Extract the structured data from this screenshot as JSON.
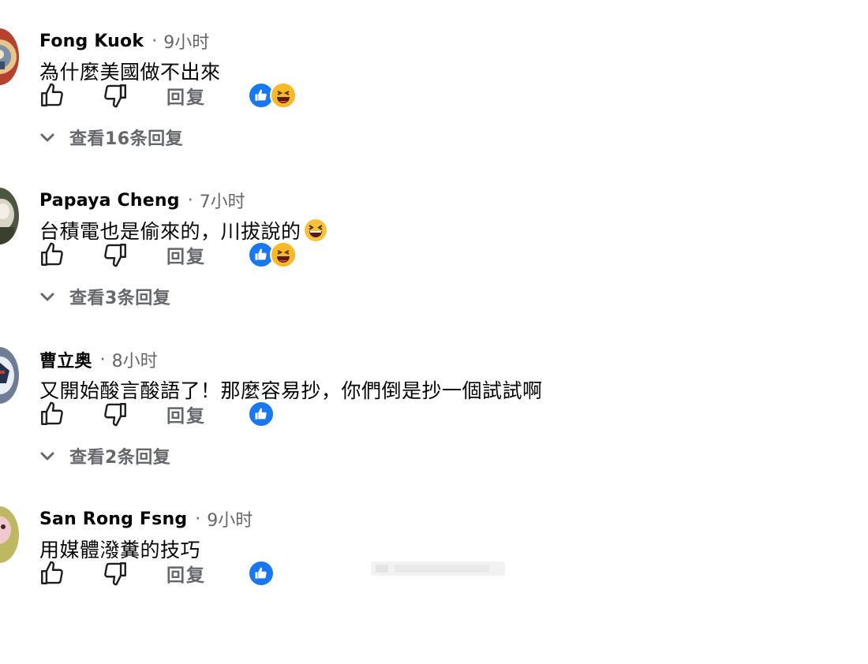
{
  "comments": [
    {
      "author": "Fong Kuok",
      "separator": "·",
      "time": "9小时",
      "text": "為什麼美國做不出來",
      "reply_label": "回复",
      "view_replies": "查看16条回复",
      "reactions": [
        "like",
        "haha"
      ],
      "avatar_color": "#b7412f"
    },
    {
      "author": "Papaya Cheng",
      "separator": "·",
      "time": "7小时",
      "text": "台積電也是偷來的，川拔說的",
      "inline_emoji": "laughing-emoji",
      "reply_label": "回复",
      "view_replies": "查看3条回复",
      "reactions": [
        "like",
        "haha"
      ],
      "avatar_color": "#5a6350"
    },
    {
      "author": "曹立奥",
      "separator": "·",
      "time": "8小时",
      "text": "又開始酸言酸語了！那麼容易抄，你們倒是抄一個試試啊",
      "reply_label": "回复",
      "view_replies": "查看2条回复",
      "reactions": [
        "like"
      ],
      "avatar_color": "#7f8da8"
    },
    {
      "author": "San Rong Fsng",
      "separator": "·",
      "time": "9小时",
      "text": "用媒體潑糞的技巧",
      "reply_label": "回复",
      "reactions": [
        "like"
      ],
      "avatar_color": "#c9c26a"
    }
  ],
  "colors": {
    "like": "#1877f2",
    "haha": "#f7b928",
    "secondary_text": "#65676b"
  },
  "icons": {
    "like": "thumbs-up-icon",
    "dislike": "thumbs-down-icon",
    "expand": "chevron-down-icon"
  }
}
